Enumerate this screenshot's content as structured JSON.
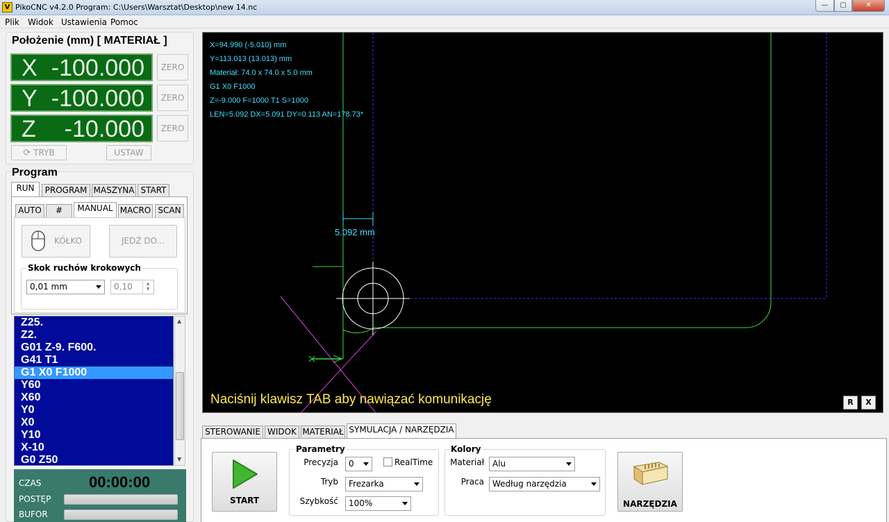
{
  "window": {
    "app_icon": "V",
    "title": "PikoCNC v4.2.0    Program: C:\\Users\\Warsztat\\Desktop\\new 14.nc",
    "min": "—",
    "max": "▢",
    "close": "✕"
  },
  "menu": [
    "Plik",
    "Widok",
    "Ustawienia",
    "Pomoc"
  ],
  "position": {
    "title": "Położenie (mm) [ MATERIAŁ ]",
    "axes": [
      {
        "letter": "X",
        "value": "-100.000",
        "zero": "ZERO"
      },
      {
        "letter": "Y",
        "value": "-100.000",
        "zero": "ZERO"
      },
      {
        "letter": "Z",
        "value": "-10.000",
        "zero": "ZERO"
      }
    ],
    "mode_button": "TRYB",
    "set_button": "USTAW"
  },
  "program": {
    "title": "Program",
    "tabs": [
      "RUN",
      "PROGRAM",
      "MASZYNA",
      "START"
    ],
    "subtabs": [
      "AUTO",
      "#",
      "MANUAL",
      "MACRO",
      "SCAN"
    ],
    "wheel_button": "KÓŁKO",
    "goto_button": "JEDŹ DO...",
    "step_group_title": "Skok ruchów krokowych",
    "step_value": "0,01 mm",
    "step_spin": "0,10"
  },
  "gcode_lines": [
    "Z25.",
    "Z2.",
    "G01 Z-9. F600.",
    "G41 T1",
    "G1 X0 F1000",
    "Y60",
    "X60",
    "Y0",
    "X0",
    "Y10",
    "X-10",
    "G0 Z50"
  ],
  "gcode_selected_index": 4,
  "status": {
    "time_label": "CZAS",
    "time_value": "00:00:00",
    "progress_label": "POSTĘP",
    "buffer_label": "BUFOR",
    "progress_fraction": 0,
    "buffer_fraction": 0
  },
  "viewport": {
    "info": [
      "X=94.990 (-5.010) mm",
      "Y=113.013 (13.013) mm",
      "Materiał: 74.0 x 74.0 x 5.0 mm",
      "G1 X0 F1000",
      "Z=-9.000 F=1000 T1 S=1000",
      "LEN=5.092 DX=5.091 DY=0.113 AN=178.73*"
    ],
    "dimension_label": "5.092 mm",
    "message": "Naciśnij klawisz TAB aby nawiązać komunikację",
    "btn_r": "R",
    "btn_x": "X"
  },
  "bottom": {
    "tabs": [
      "STEROWANIE",
      "WIDOK",
      "MATERIAŁ",
      "SYMULACJA / NARZĘDZIA"
    ],
    "start_button": "START",
    "params_title": "Parametry",
    "precision_label": "Precyzja",
    "precision_value": "0",
    "realtime_label": "RealTime",
    "mode_label": "Tryb",
    "mode_value": "Frezarka",
    "speed_label": "Szybkość",
    "speed_value": "100%",
    "colors_title": "Kolory",
    "material_label": "Materiał",
    "material_value": "Alu",
    "work_label": "Praca",
    "work_value": "Według narzędzia",
    "tools_button": "NARZĘDZIA"
  },
  "colors": {
    "axis_display_bg": "#0a6b14",
    "gcode_bg": "#000c99",
    "gcode_selected": "#3399ff",
    "toolpath": "#3ddc3d",
    "material_outline": "#2a3cff",
    "info_text": "#3ee0ff",
    "message_text": "#ffe94a"
  }
}
